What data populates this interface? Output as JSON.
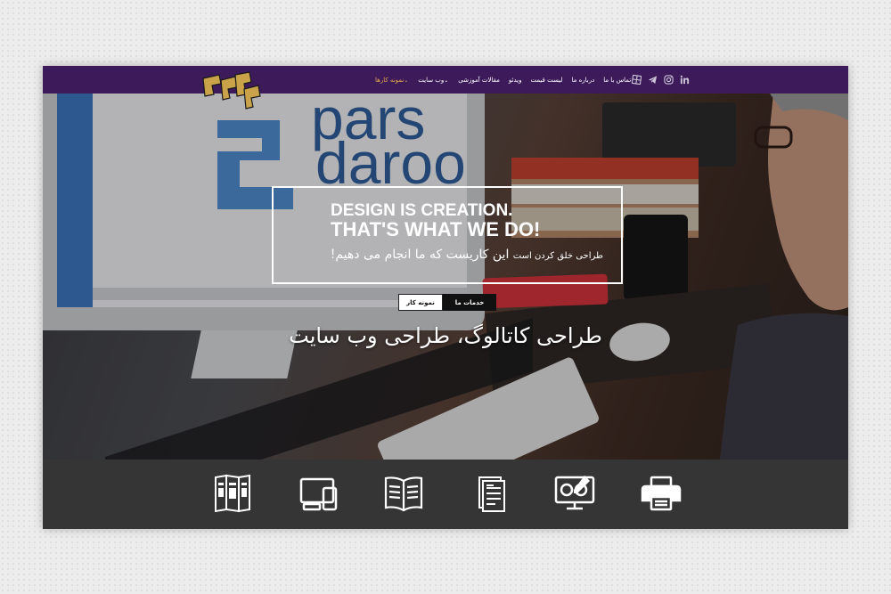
{
  "nav": {
    "menu": [
      {
        "label": "تماس با ما",
        "has_caret": false,
        "active": false
      },
      {
        "label": "درباره ما",
        "has_caret": false,
        "active": false
      },
      {
        "label": "لیست قیمت",
        "has_caret": false,
        "active": false
      },
      {
        "label": "ویدئو",
        "has_caret": false,
        "active": false
      },
      {
        "label": "مقالات آموزشی",
        "has_caret": false,
        "active": false
      },
      {
        "label": "وب سایت",
        "has_caret": true,
        "active": false
      },
      {
        "label": "نمونه کارها",
        "has_caret": true,
        "active": true
      }
    ],
    "social_icons": [
      "windows-icon",
      "telegram-icon",
      "instagram-icon",
      "linkedin-icon"
    ],
    "bg_color": "#3d1b5a",
    "active_color": "#e6a94a"
  },
  "hero": {
    "tagline_en_line1": "DESIGN IS CREATION.",
    "tagline_en_line2": "THAT'S WHAT WE DO!",
    "tagline_fa_small": "طراحی خلق کردن است",
    "tagline_fa_main": "این کاریست که ما انجام می دهیم!",
    "button_portfolio": "نمونه کار",
    "button_services": "خدمات ما",
    "subtitle": "طراحی کاتالوگ، طراحی وب سایت"
  },
  "services": {
    "icons": [
      "brochure-icon",
      "responsive-devices-icon",
      "catalog-book-icon",
      "document-icon",
      "web-design-icon",
      "printer-icon"
    ]
  }
}
